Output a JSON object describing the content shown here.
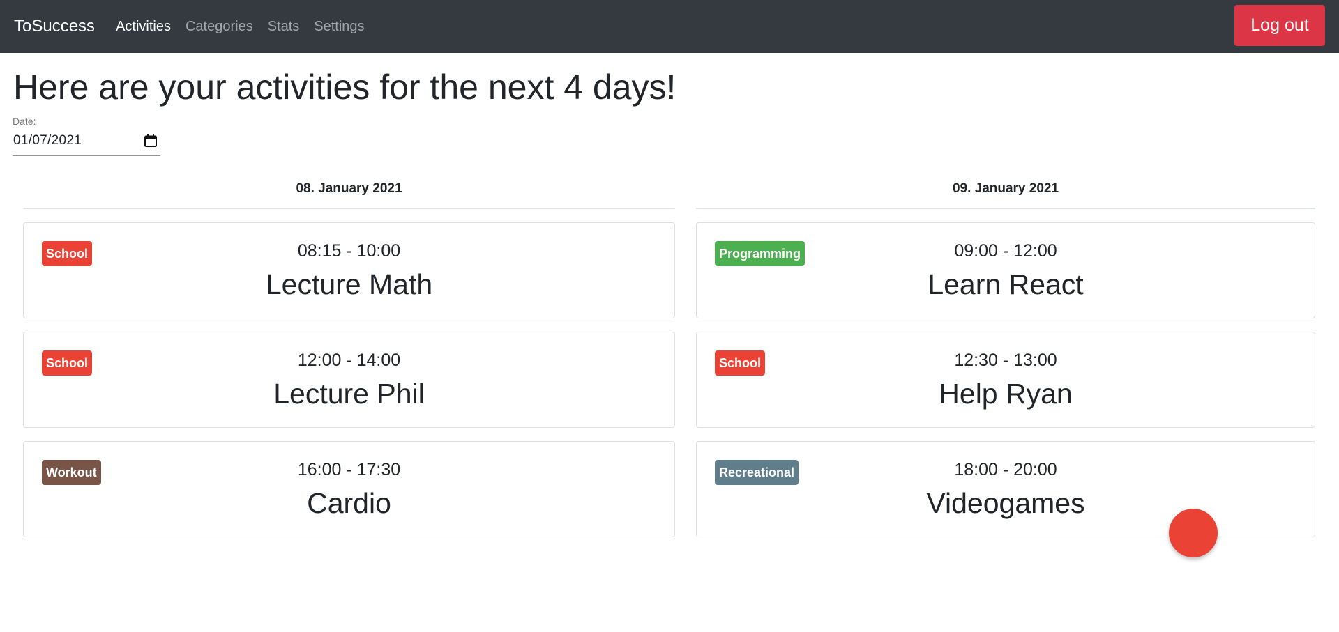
{
  "nav": {
    "brand": "ToSuccess",
    "links": [
      {
        "label": "Activities",
        "active": true
      },
      {
        "label": "Categories",
        "active": false
      },
      {
        "label": "Stats",
        "active": false
      },
      {
        "label": "Settings",
        "active": false
      }
    ],
    "logout_label": "Log out"
  },
  "page": {
    "title": "Here are your activities for the next 4 days!",
    "date_label": "Date:",
    "date_value": "01/07/2021"
  },
  "colors": {
    "navbar": "#343a40",
    "logout": "#dc3545",
    "school": "#ea4335",
    "programming": "#4caf50",
    "workout": "#795548",
    "recreational": "#607d8b",
    "fab": "#ea4335"
  },
  "days": [
    {
      "date": "08. January 2021",
      "activities": [
        {
          "category": "School",
          "category_color": "#ea4335",
          "time": "08:15 - 10:00",
          "title": "Lecture Math"
        },
        {
          "category": "School",
          "category_color": "#ea4335",
          "time": "12:00 - 14:00",
          "title": "Lecture Phil"
        },
        {
          "category": "Workout",
          "category_color": "#795548",
          "time": "16:00 - 17:30",
          "title": "Cardio"
        }
      ]
    },
    {
      "date": "09. January 2021",
      "activities": [
        {
          "category": "Programming",
          "category_color": "#4caf50",
          "time": "09:00 - 12:00",
          "title": "Learn React"
        },
        {
          "category": "School",
          "category_color": "#ea4335",
          "time": "12:30 - 13:00",
          "title": "Help Ryan"
        },
        {
          "category": "Recreational",
          "category_color": "#607d8b",
          "time": "18:00 - 20:00",
          "title": "Videogames"
        }
      ]
    }
  ]
}
